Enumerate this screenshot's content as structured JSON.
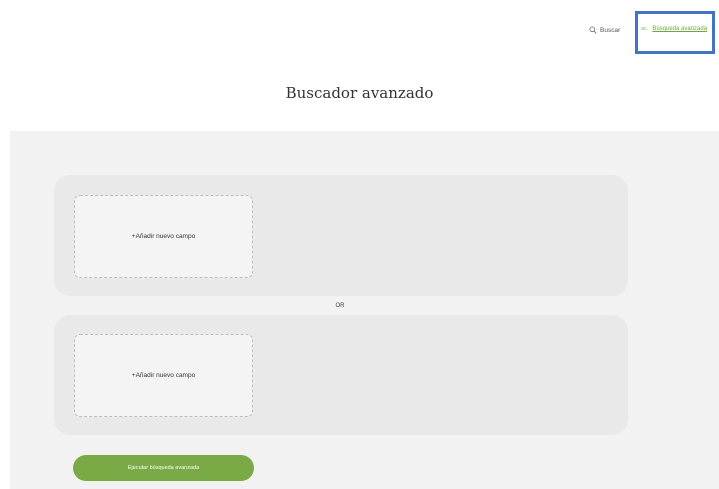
{
  "header": {
    "search_label": "Buscar",
    "search_icon": "search-icon",
    "advanced_icon": "ac.",
    "advanced_label": "Búsqueda avanzada",
    "highlight_color": "#4472c4",
    "accent_color": "#6fa63a"
  },
  "main": {
    "title": "Buscador avanzado",
    "groups": [
      {
        "add_field_label": "+Añadir nuevo campo"
      },
      {
        "add_field_label": "+Añadir nuevo campo"
      }
    ],
    "or_label": "OR",
    "run_button_label": "Ejecutar búsqueda avanzada",
    "run_button_color": "#7aaa45"
  }
}
